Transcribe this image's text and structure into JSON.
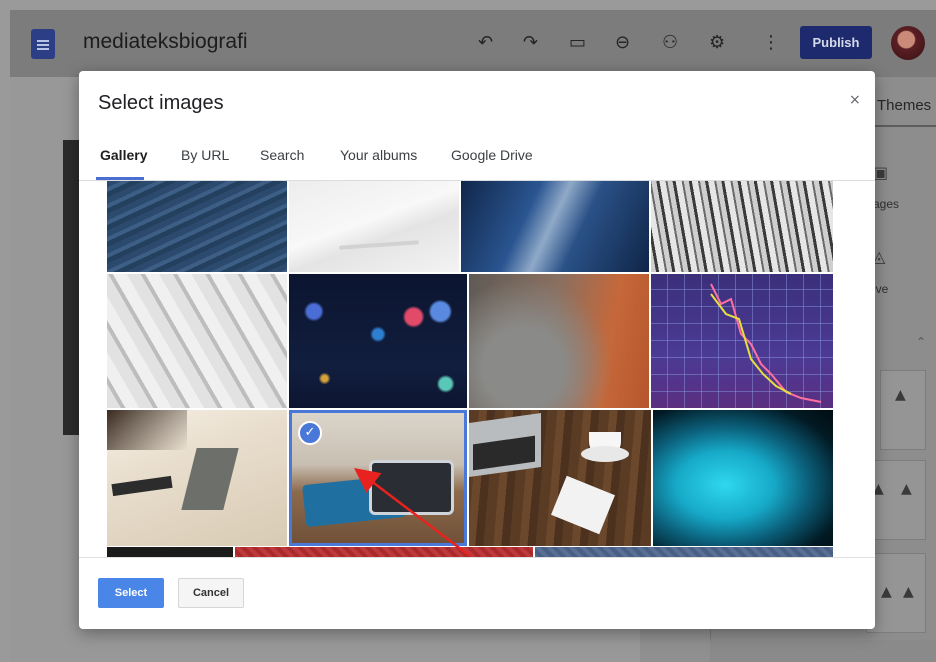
{
  "app": {
    "site_title": "mediateksbiografi",
    "publish_label": "Publish",
    "toolbar_icons": [
      "undo-icon",
      "redo-icon",
      "preview-icon",
      "link-icon",
      "share-icon",
      "settings-icon",
      "more-icon"
    ],
    "toolbar_glyphs": [
      "↶",
      "↷",
      "▭",
      "⊖",
      "⚇",
      "⚙",
      "⋮"
    ]
  },
  "side_panel": {
    "themes_tab": "Themes",
    "images_label": "ages",
    "drive_label": "ive"
  },
  "dialog": {
    "title": "Select images",
    "close_glyph": "×",
    "tabs": [
      {
        "label": "Gallery",
        "active": true
      },
      {
        "label": "By URL",
        "active": false
      },
      {
        "label": "Search",
        "active": false
      },
      {
        "label": "Your albums",
        "active": false
      },
      {
        "label": "Google Drive",
        "active": false
      }
    ],
    "gallery": {
      "images": [
        {
          "name": "blue-textured-rock",
          "selected": false
        },
        {
          "name": "white-snow-feather",
          "selected": false
        },
        {
          "name": "blue-wave-abstract",
          "selected": false
        },
        {
          "name": "audio-mixer-console",
          "selected": false
        },
        {
          "name": "white-geometric-tiles",
          "selected": false
        },
        {
          "name": "night-bokeh-lights",
          "selected": false
        },
        {
          "name": "orange-blur-gradient",
          "selected": false
        },
        {
          "name": "stock-chart-screen",
          "selected": false
        },
        {
          "name": "office-desk-laptop",
          "selected": false
        },
        {
          "name": "blue-notebook-tablet",
          "selected": true
        },
        {
          "name": "laptop-coffee-notebook",
          "selected": false
        },
        {
          "name": "cyan-glow-abstract",
          "selected": false
        },
        {
          "name": "dark-strip",
          "selected": false
        },
        {
          "name": "red-pattern-strip",
          "selected": false
        },
        {
          "name": "blue-pattern-strip",
          "selected": false
        }
      ],
      "check_glyph": "✓"
    },
    "select_label": "Select",
    "cancel_label": "Cancel"
  },
  "colors": {
    "accent": "#4a86e8",
    "selection": "#4a78d8",
    "publish_bg": "#1e2a6e",
    "annotation_arrow": "#e8231f"
  }
}
